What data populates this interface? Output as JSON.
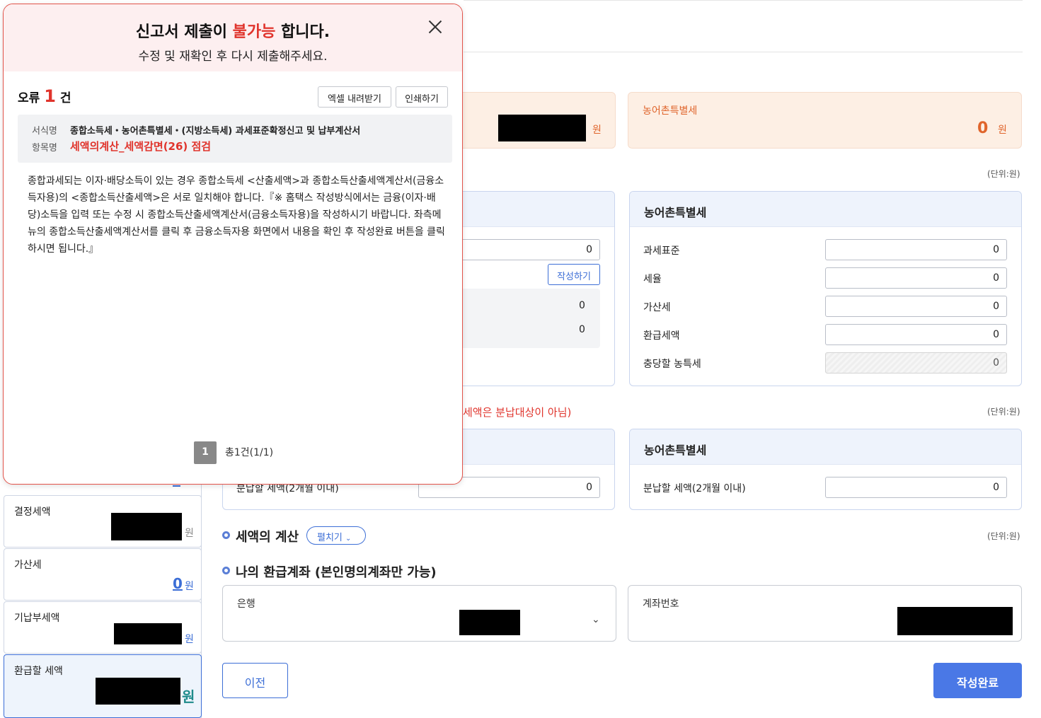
{
  "summary": {
    "won": "원",
    "rural_label": "농어촌특별세",
    "rural_value": "0"
  },
  "units": {
    "unit1": "(단위:원)",
    "unit2": "(단위:원)",
    "unit3": "(단위:원)"
  },
  "main_card": {
    "value1": "0",
    "write_button": "작성하기",
    "sub_value1": "0",
    "sub_value2": "0"
  },
  "rural_card": {
    "title": "농어촌특별세",
    "rows": [
      {
        "label": "과세표준",
        "value": "0"
      },
      {
        "label": "세율",
        "value": "0"
      },
      {
        "label": "가산세",
        "value": "0"
      },
      {
        "label": "환급세액",
        "value": "0"
      },
      {
        "label": "충당할 농특세",
        "value": "0"
      }
    ]
  },
  "installment": {
    "notice": "세액은 분납대상이 아님)",
    "left_label": "분납할 세액(2개월 이내)",
    "left_value": "0",
    "right_title": "농어촌특별세",
    "right_label": "분납할 세액(2개월 이내)",
    "right_value": "0"
  },
  "sections": {
    "tax_calc": "세액의 계산",
    "expand_button": "펼치기",
    "refund_account": "나의 환급계좌 (본인명의계좌만 가능)"
  },
  "account": {
    "bank_label": "은행",
    "number_label": "계좌번호"
  },
  "buttons": {
    "prev": "이전",
    "complete": "작성완료"
  },
  "sidebar": {
    "items": [
      {
        "label": "결정세액",
        "won": "원"
      },
      {
        "label": "가산세",
        "value": "0",
        "won": "원"
      },
      {
        "label": "기납부세액",
        "won": "원"
      },
      {
        "label": "환급할 세액",
        "won": "원"
      }
    ]
  },
  "modal": {
    "title_pre": "신고서 제출이 ",
    "title_red": "불가능",
    "title_post": " 합니다.",
    "subtitle": "수정 및 재확인 후 다시 제출해주세요.",
    "error_label": "오류",
    "error_count": "1",
    "error_unit": "건",
    "excel_button": "엑셀 내려받기",
    "print_button": "인쇄하기",
    "form_key": "서식명",
    "form_value": "종합소득세・농어촌특별세・(지방소득세) 과세표준확정신고 및 납부계산서",
    "item_key": "항목명",
    "item_value": "세액의계산_세액감면(26) 점검",
    "message": "종합과세되는 이자·배당소득이 있는 경우 종합소득세 <산출세액>과 종합소득산출세액계산서(금융소득자용)의 <종합소득산출세액>은 서로 일치해야 합니다.『※ 홈택스 작성방식에서는 금융(이자·배당)소득을 입력 또는 수정 시 종합소득산출세액계산서(금융소득자용)을 작성하시기 바랍니다. 좌측메뉴의 종합소득산출세액계산서를 클릭 후 금융소득자용 화면에서 내용을 확인 후 작성완료 버튼을 클릭하시면 됩니다.』",
    "page_number": "1",
    "page_text": "총1건(1/1)"
  }
}
